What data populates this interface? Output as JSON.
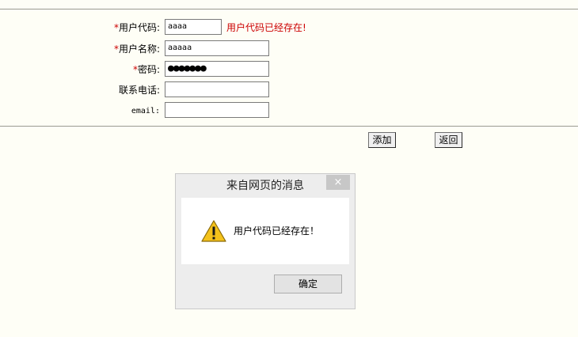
{
  "form": {
    "required_mark": "*",
    "user_code": {
      "label": "用户代码:",
      "value": "aaaa",
      "error": "用户代码已经存在!"
    },
    "user_name": {
      "label": "用户名称:",
      "value": "aaaaa"
    },
    "password": {
      "label": "密码:",
      "value": "●●●●●●●"
    },
    "phone": {
      "label": "联系电话:",
      "value": ""
    },
    "email": {
      "label": "email:",
      "value": ""
    }
  },
  "actions": {
    "add_label": "添加",
    "back_label": "返回"
  },
  "dialog": {
    "title": "来自网页的消息",
    "close_glyph": "×",
    "message": "用户代码已经存在！",
    "ok_label": "确定"
  },
  "colors": {
    "page_bg": "#FEFEF6",
    "required": "#CC0000",
    "error": "#CC0000",
    "warning_yellow": "#F4C21B"
  }
}
